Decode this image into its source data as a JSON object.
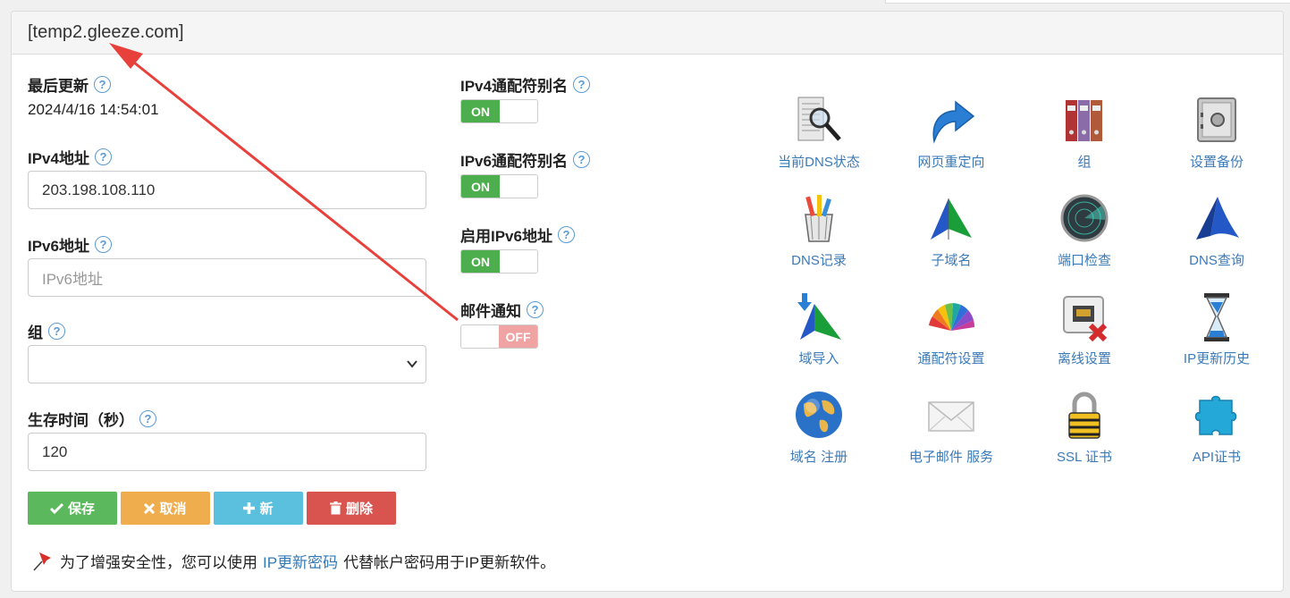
{
  "panel": {
    "title": "[temp2.gleeze.com]"
  },
  "left": {
    "last_update_label": "最后更新",
    "last_update_value": "2024/4/16 14:54:01",
    "ipv4_label": "IPv4地址",
    "ipv4_value": "203.198.108.110",
    "ipv6_label": "IPv6地址",
    "ipv6_placeholder": "IPv6地址",
    "group_label": "组",
    "group_value": "",
    "ttl_label": "生存时间（秒）",
    "ttl_value": "120"
  },
  "middle": {
    "ipv4_wildcard_label": "IPv4通配符别名",
    "ipv4_wildcard_state": "ON",
    "ipv6_wildcard_label": "IPv6通配符别名",
    "ipv6_wildcard_state": "ON",
    "enable_ipv6_label": "启用IPv6地址",
    "enable_ipv6_state": "ON",
    "mail_notify_label": "邮件通知",
    "mail_notify_state": "OFF"
  },
  "buttons": {
    "save": "保存",
    "cancel": "取消",
    "new": "新",
    "delete": "删除"
  },
  "note": {
    "before": "为了增强安全性，您可以使用",
    "link": "IP更新密码",
    "after": "代替帐户密码用于IP更新软件。"
  },
  "help_glyph": "?",
  "tiles": [
    {
      "label": "当前DNS状态",
      "icon": "dns-status-icon"
    },
    {
      "label": "网页重定向",
      "icon": "web-redirect-icon"
    },
    {
      "label": "组",
      "icon": "group-folders-icon"
    },
    {
      "label": "设置备份",
      "icon": "backup-safe-icon"
    },
    {
      "label": "DNS记录",
      "icon": "dns-records-icon"
    },
    {
      "label": "子域名",
      "icon": "subdomain-flag-icon"
    },
    {
      "label": "端口检查",
      "icon": "port-radar-icon"
    },
    {
      "label": "DNS查询",
      "icon": "dns-query-icon"
    },
    {
      "label": "域导入",
      "icon": "domain-import-icon"
    },
    {
      "label": "通配符设置",
      "icon": "wildcard-color-fan-icon"
    },
    {
      "label": "离线设置",
      "icon": "offline-settings-icon"
    },
    {
      "label": "IP更新历史",
      "icon": "hourglass-icon"
    },
    {
      "label": "域名 注册",
      "icon": "globe-icon"
    },
    {
      "label": "电子邮件 服务",
      "icon": "envelope-icon"
    },
    {
      "label": "SSL 证书",
      "icon": "padlock-icon"
    },
    {
      "label": "API证书",
      "icon": "puzzle-icon"
    }
  ],
  "colors": {
    "on": "#4cae4c",
    "off": "#f0a3a3",
    "link": "#337ab7",
    "annotation_arrow": "#e8413c"
  }
}
